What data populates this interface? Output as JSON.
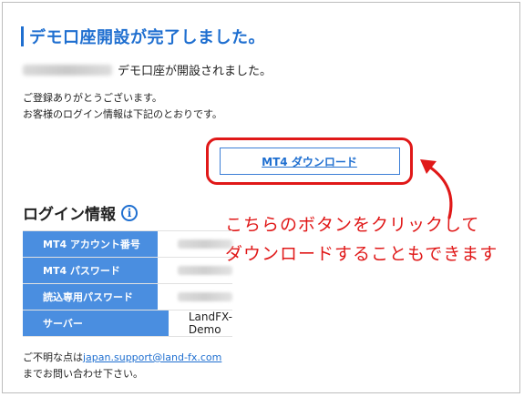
{
  "title": "デモ口座開設が完了しました。",
  "user_line": {
    "suffix": "デモ口座が開設されました。"
  },
  "intro": {
    "line1": "ご登録ありがとうございます。",
    "line2": "お客様のログイン情報は下記のとおりです。"
  },
  "download_button": {
    "label": "MT4 ダウンロード"
  },
  "callout": {
    "line1": "こちらのボタンをクリックして",
    "line2": "ダウンロードすることもできます"
  },
  "login": {
    "heading": "ログイン情報",
    "info_icon": "i",
    "rows": [
      {
        "label": "MT4 アカウント番号",
        "value": ""
      },
      {
        "label": "MT4 パスワード",
        "value": ""
      },
      {
        "label": "読込専用パスワード",
        "value": ""
      },
      {
        "label": "サーバー",
        "value": "LandFX-Demo"
      }
    ]
  },
  "footer": {
    "prefix": "ご不明な点は",
    "email": "japan.support@land-fx.com",
    "line2": "までお問い合わせ下さい。"
  },
  "colors": {
    "accent_blue": "#1f6fd0",
    "table_label_bg": "#4a8ee0",
    "highlight_red": "#e01818"
  },
  "icons": {
    "info": "info-icon",
    "arrow": "curved-arrow-icon"
  }
}
